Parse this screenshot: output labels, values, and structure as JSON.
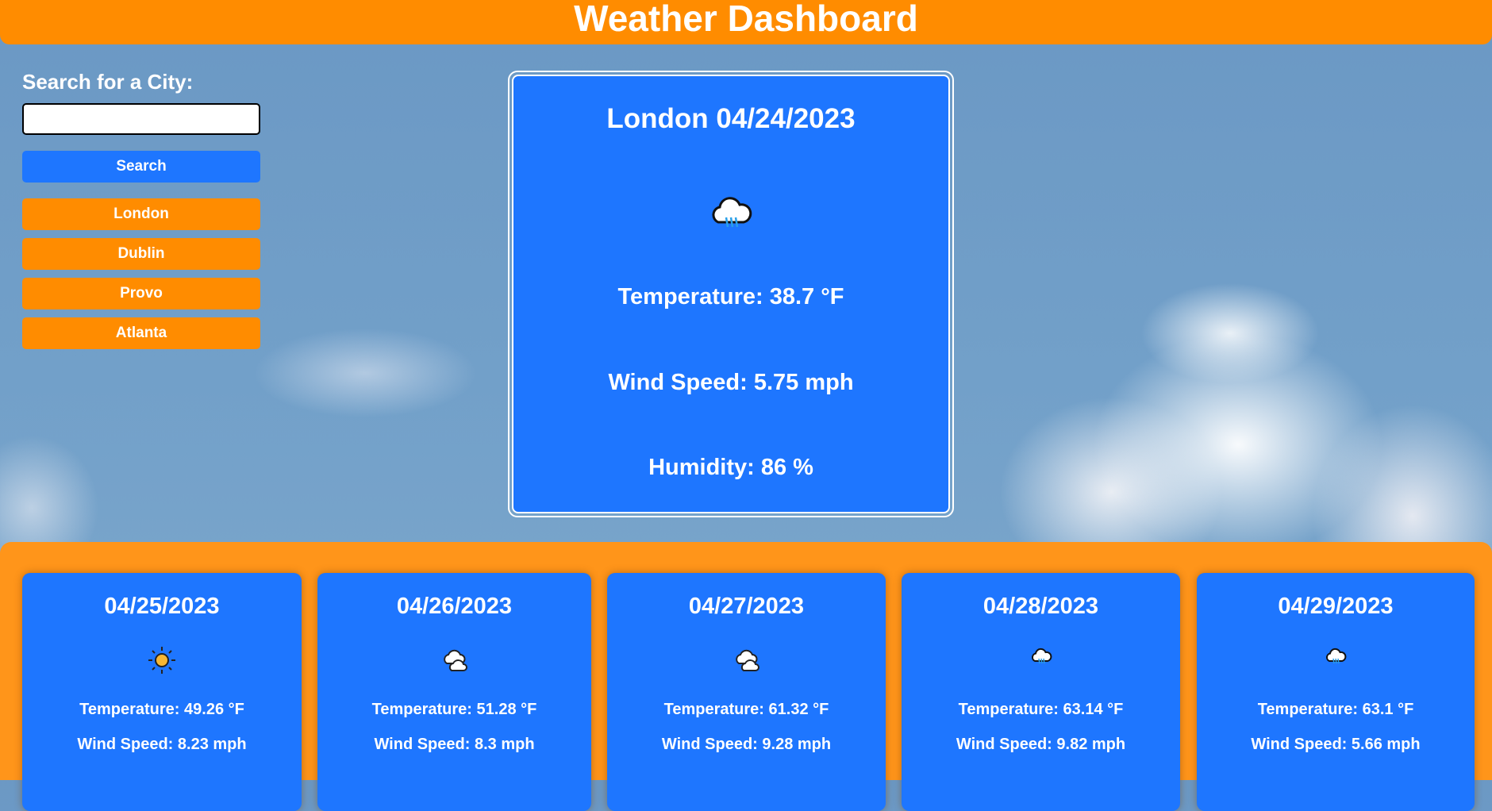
{
  "header": {
    "title": "Weather Dashboard"
  },
  "sidebar": {
    "search_label": "Search for a City:",
    "search_value": "",
    "search_placeholder": "",
    "search_button": "Search",
    "history": [
      "London",
      "Dublin",
      "Provo",
      "Atlanta"
    ]
  },
  "current": {
    "title": "London 04/24/2023",
    "icon": "rain-cloud-icon",
    "temperature": "Temperature: 38.7 °F",
    "wind": "Wind Speed: 5.75 mph",
    "humidity": "Humidity: 86 %"
  },
  "forecast": [
    {
      "date": "04/25/2023",
      "icon": "sun-icon",
      "temperature": "Temperature: 49.26 °F",
      "wind": "Wind Speed: 8.23 mph"
    },
    {
      "date": "04/26/2023",
      "icon": "clouds-icon",
      "temperature": "Temperature: 51.28 °F",
      "wind": "Wind Speed: 8.3 mph"
    },
    {
      "date": "04/27/2023",
      "icon": "clouds-icon",
      "temperature": "Temperature: 61.32 °F",
      "wind": "Wind Speed: 9.28 mph"
    },
    {
      "date": "04/28/2023",
      "icon": "rain-cloud-icon",
      "temperature": "Temperature: 63.14 °F",
      "wind": "Wind Speed: 9.82 mph"
    },
    {
      "date": "04/29/2023",
      "icon": "rain-cloud-icon",
      "temperature": "Temperature: 63.1 °F",
      "wind": "Wind Speed: 5.66 mph"
    }
  ],
  "colors": {
    "orange": "#ff8c00",
    "blue": "#1e76ff"
  }
}
